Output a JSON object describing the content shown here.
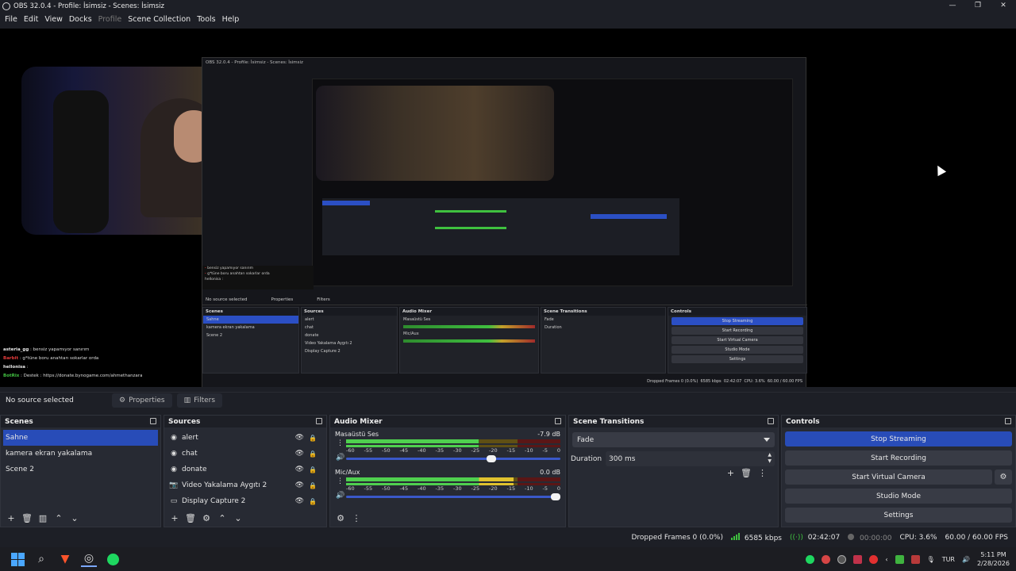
{
  "window": {
    "title": "OBS 32.0.4 - Profile: İsimsiz - Scenes: İsimsiz",
    "minimize": "—",
    "restore": "❐",
    "close": "✕"
  },
  "menu": [
    "File",
    "Edit",
    "View",
    "Docks",
    "Profile",
    "Scene Collection",
    "Tools",
    "Help"
  ],
  "preview": {
    "chat_lines": [
      {
        "name": "asteria_gg",
        "text": " : bensiz yapamıyor sanırım"
      },
      {
        "name": "Barbit",
        "text": " : g*tüne boru anahtarı sokarlar orda"
      },
      {
        "name": "hellonisa",
        "text": " : "
      },
      {
        "name": "BotRix",
        "text": " : Destek : https://donate.bynogame.com/ahmethanzara"
      }
    ],
    "nested_title": "OBS 32.0.4 - Profile: İsimsiz - Scenes: İsimsiz"
  },
  "source_toolbar": {
    "no_source": "No source selected",
    "properties": "Properties",
    "filters": "Filters"
  },
  "scenes": {
    "title": "Scenes",
    "items": [
      "Sahne",
      "kamera ekran yakalama",
      "Scene 2"
    ],
    "selected_index": 0
  },
  "sources": {
    "title": "Sources",
    "items": [
      {
        "label": "alert",
        "icon": "browser-icon"
      },
      {
        "label": "chat",
        "icon": "browser-icon"
      },
      {
        "label": "donate",
        "icon": "browser-icon"
      },
      {
        "label": "Video Yakalama Aygıtı 2",
        "icon": "camera-icon"
      },
      {
        "label": "Display Capture 2",
        "icon": "monitor-icon"
      }
    ]
  },
  "audio_mixer": {
    "title": "Audio Mixer",
    "channels": [
      {
        "name": "Masaüstü Ses",
        "db": "-7.9 dB",
        "level": 0.62,
        "volume": 0.7
      },
      {
        "name": "Mic/Aux",
        "db": "0.0 dB",
        "level": 0.78,
        "volume": 1.0
      }
    ],
    "scale": [
      "-60",
      "-55",
      "-50",
      "-45",
      "-40",
      "-35",
      "-30",
      "-25",
      "-20",
      "-15",
      "-10",
      "-5",
      "0"
    ]
  },
  "transitions": {
    "title": "Scene Transitions",
    "selected": "Fade",
    "duration_label": "Duration",
    "duration_value": "300 ms"
  },
  "controls": {
    "title": "Controls",
    "stop_streaming": "Stop Streaming",
    "start_recording": "Start Recording",
    "start_virtual_camera": "Start Virtual Camera",
    "studio_mode": "Studio Mode",
    "settings": "Settings"
  },
  "status": {
    "dropped_frames": "Dropped Frames 0 (0.0%)",
    "bitrate": "6585 kbps",
    "stream_time": "02:42:07",
    "rec_time": "00:00:00",
    "cpu": "CPU: 3.6%",
    "fps": "60.00 / 60.00 FPS"
  },
  "taskbar": {
    "lang": "TUR",
    "time": "5:11 PM",
    "date": "2/28/2026"
  },
  "colors": {
    "accent": "#284cb8",
    "background": "#1d1f26",
    "dock": "#272a33",
    "meter_green": "#4fd04f",
    "meter_yellow": "#e0c22e",
    "meter_red": "#d63030"
  }
}
